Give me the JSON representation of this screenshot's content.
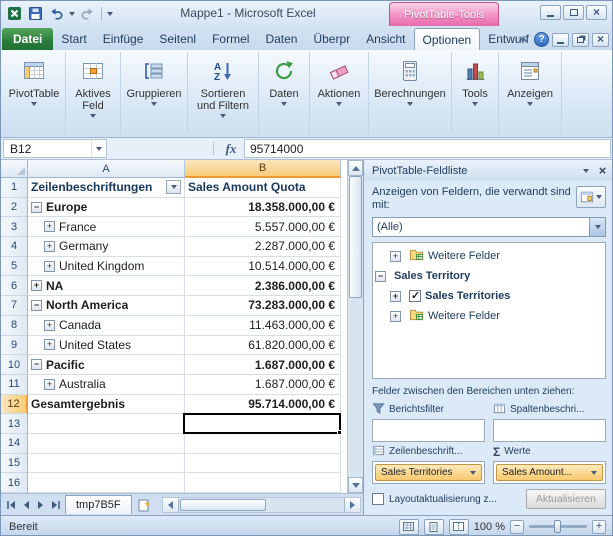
{
  "window": {
    "title": "Mappe1 - Microsoft Excel",
    "context_label": "PivotTable-Tools"
  },
  "ribbon": {
    "file_tab": "Datei",
    "tabs": [
      "Start",
      "Einfüge",
      "Seitenl",
      "Formel",
      "Daten",
      "Überpr",
      "Ansicht",
      "Optionen",
      "Entwurf"
    ],
    "active_tab": "Optionen",
    "buttons": [
      "PivotTable",
      "Aktives Feld",
      "Gruppieren",
      "Sortieren und Filtern",
      "Daten",
      "Aktionen",
      "Berechnungen",
      "Tools",
      "Anzeigen"
    ]
  },
  "formula_bar": {
    "name_box": "B12",
    "fx": "fx",
    "value": "95714000"
  },
  "sheet": {
    "columns": [
      "A",
      "B"
    ],
    "selected_cell": "B12",
    "rows": [
      {
        "n": "1",
        "a": "Zeilenbeschriftungen",
        "b": "Sales Amount Quota"
      },
      {
        "n": "2",
        "a": "Europe",
        "b": "18.358.000,00 €"
      },
      {
        "n": "3",
        "a": "France",
        "b": "5.557.000,00 €"
      },
      {
        "n": "4",
        "a": "Germany",
        "b": "2.287.000,00 €"
      },
      {
        "n": "5",
        "a": "United Kingdom",
        "b": "10.514.000,00 €"
      },
      {
        "n": "6",
        "a": "NA",
        "b": "2.386.000,00 €"
      },
      {
        "n": "7",
        "a": "North America",
        "b": "73.283.000,00 €"
      },
      {
        "n": "8",
        "a": "Canada",
        "b": "11.463.000,00 €"
      },
      {
        "n": "9",
        "a": "United States",
        "b": "61.820.000,00 €"
      },
      {
        "n": "10",
        "a": "Pacific",
        "b": "1.687.000,00 €"
      },
      {
        "n": "11",
        "a": "Australia",
        "b": "1.687.000,00 €"
      },
      {
        "n": "12",
        "a": "Gesamtergebnis",
        "b": "95.714.000,00 €"
      },
      {
        "n": "13",
        "a": "",
        "b": ""
      },
      {
        "n": "14",
        "a": "",
        "b": ""
      },
      {
        "n": "15",
        "a": "",
        "b": ""
      },
      {
        "n": "16",
        "a": "",
        "b": ""
      }
    ],
    "sheet_tab": "tmp7B5F"
  },
  "field_list": {
    "title": "PivotTable-Feldliste",
    "show_fields_label": "Anzeigen von Feldern, die verwandt sind mit:",
    "filter_value": "(Alle)",
    "tree": [
      "Weitere Felder",
      "Sales Territory",
      "Sales Territories",
      "Weitere Felder"
    ],
    "drag_label": "Felder zwischen den Bereichen unten ziehen:",
    "areas": {
      "report_filter": "Berichtsfilter",
      "column_labels": "Spaltenbeschri...",
      "row_labels": "Zeilenbeschrift...",
      "values": "Werte"
    },
    "row_field": "Sales Territories",
    "value_field": "Sales Amount...",
    "defer_label": "Layoutaktualisierung z...",
    "update_button": "Aktualisieren"
  },
  "status_bar": {
    "ready": "Bereit",
    "zoom": "100 %"
  }
}
